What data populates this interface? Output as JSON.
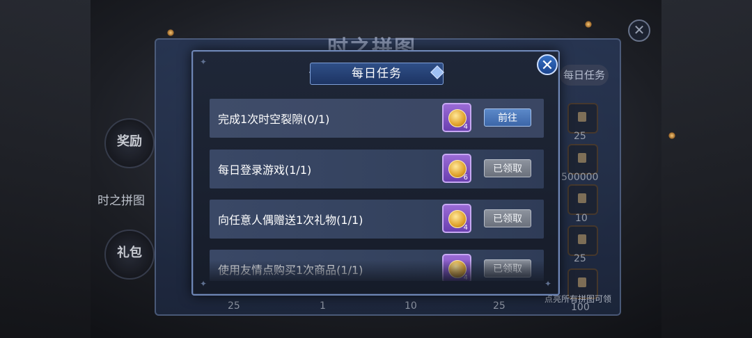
{
  "background": {
    "panel_title": "时之拼图",
    "tab_label": "每日任务",
    "side_buttons": [
      {
        "label": "奖励"
      },
      {
        "label": "时之拼图"
      },
      {
        "label": "礼包"
      }
    ],
    "reward_numbers": [
      "25",
      "500000",
      "10",
      "25",
      "100"
    ],
    "bottom_numbers": [
      "25",
      "1",
      "10",
      "25"
    ],
    "hint": "点亮所有拼图可领"
  },
  "dialog": {
    "title": "每日任务",
    "tasks": [
      {
        "label": "完成1次时空裂隙(0/1)",
        "reward_icon": "gold-coin-icon",
        "reward_count": "4",
        "button": "前往",
        "status": "go"
      },
      {
        "label": "每日登录游戏(1/1)",
        "reward_icon": "gold-coin-icon",
        "reward_count": "6",
        "button": "已领取",
        "status": "claimed"
      },
      {
        "label": "向任意人偶赠送1次礼物(1/1)",
        "reward_icon": "gold-coin-icon",
        "reward_count": "4",
        "button": "已领取",
        "status": "claimed"
      },
      {
        "label": "使用友情点购买1次商品(1/1)",
        "reward_icon": "gold-coin-icon",
        "reward_count": "4",
        "button": "已领取",
        "status": "claimed"
      }
    ]
  },
  "colors": {
    "go_button": "#4a76b8",
    "claimed_button": "#7b818c",
    "dialog_border": "#6f87b6",
    "reward_frame": "#8a5cc8"
  }
}
